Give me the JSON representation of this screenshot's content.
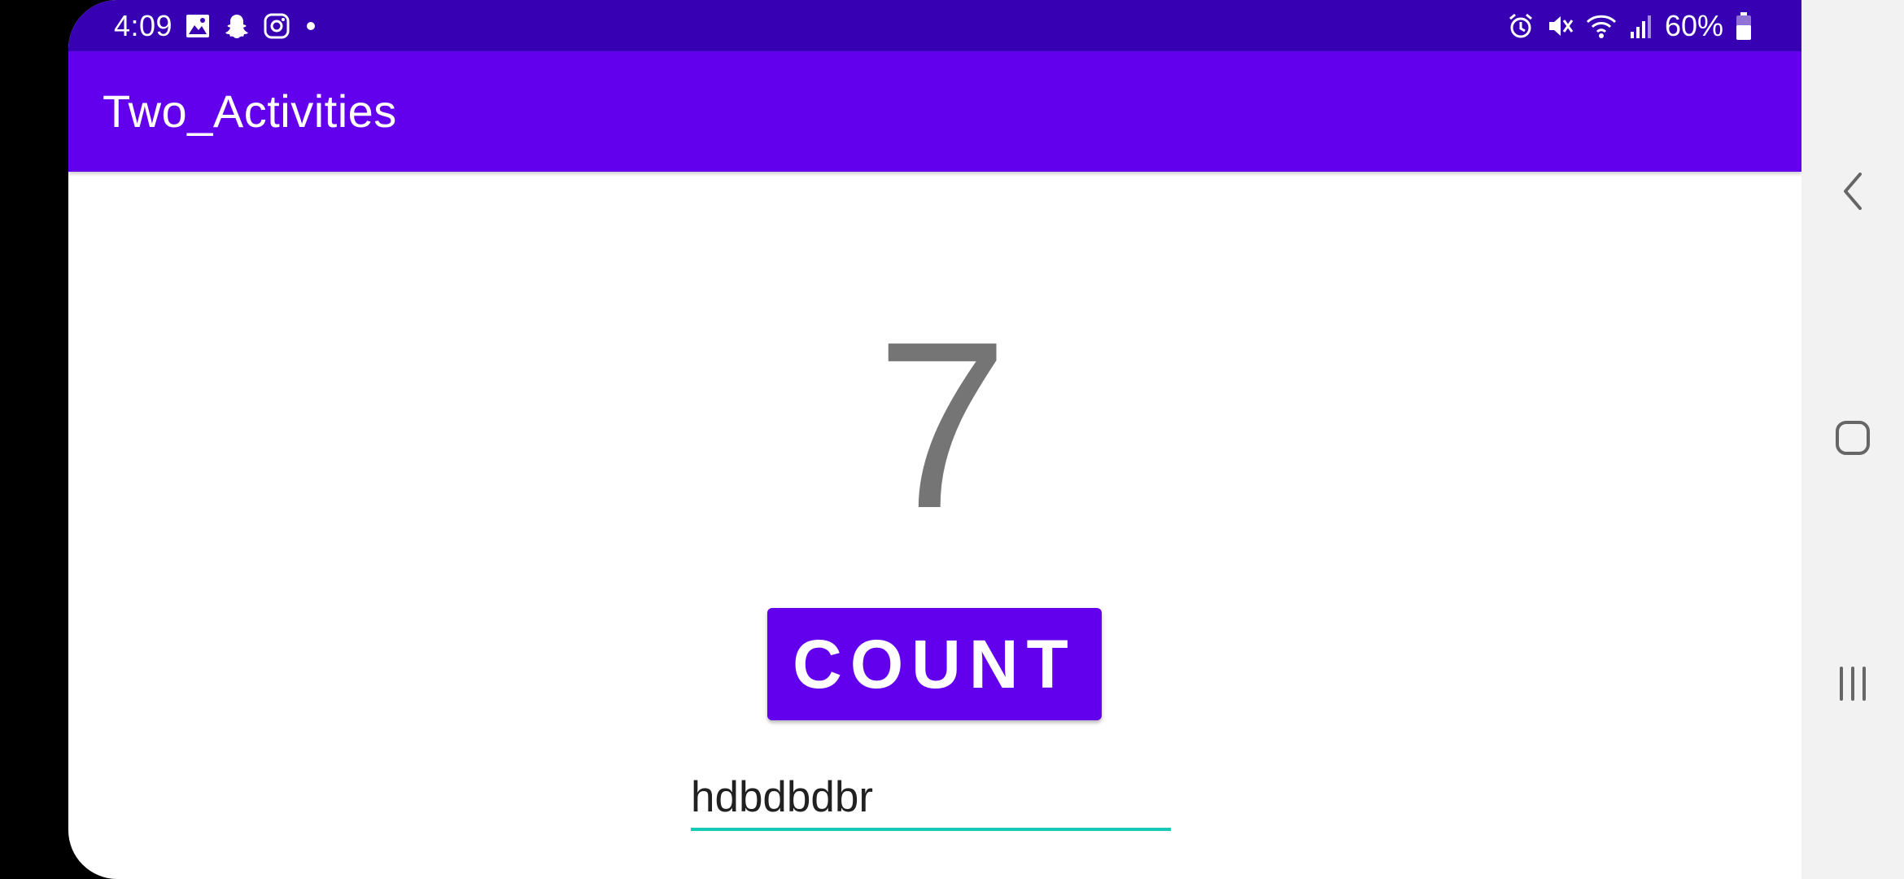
{
  "status_bar": {
    "time": "4:09",
    "notification_icons": [
      "gallery-icon",
      "snapchat-icon",
      "instagram-icon",
      "dot-icon"
    ],
    "system_icons": [
      "alarm-icon",
      "mute-icon",
      "wifi-icon",
      "signal-icon"
    ],
    "battery_percent": "60%",
    "battery_level": 0.6
  },
  "app_bar": {
    "title": "Two_Activities"
  },
  "main": {
    "count_value": "7",
    "count_button_label": "COUNT",
    "input_value": "hdbdbdbr"
  },
  "nav_bar": {
    "buttons": [
      "back-icon",
      "home-icon",
      "recents-icon"
    ]
  },
  "colors": {
    "status_bar": "#3700b3",
    "app_bar": "#6200ee",
    "button": "#6200ee",
    "count_text": "#757575",
    "input_underline": "#18c9b5",
    "nav_bar_bg": "#f2f2f2"
  }
}
